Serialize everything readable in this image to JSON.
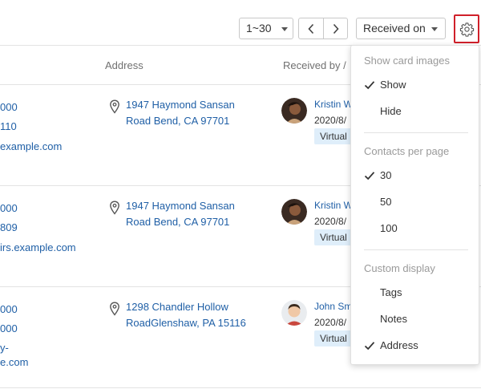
{
  "toolbar": {
    "pager_label": "1~30",
    "sort_label": "Received on"
  },
  "table": {
    "headers": {
      "address": "Address",
      "received_by": "Received by /"
    },
    "rows": [
      {
        "left_lines": [
          "000",
          "110",
          "example.com"
        ],
        "address_lines": [
          "1947 Haymond Sansan",
          "Road Bend, CA 97701"
        ],
        "received_name": "Kristin W",
        "received_date": "2020/8/",
        "tag": "Virtual"
      },
      {
        "left_lines": [
          "000",
          "809",
          "irs.example.com"
        ],
        "address_lines": [
          "1947 Haymond Sansan",
          "Road Bend, CA 97701"
        ],
        "received_name": "Kristin W",
        "received_date": "2020/8/",
        "tag": "Virtual"
      },
      {
        "left_lines": [
          "000",
          "000",
          "y-",
          "e.com"
        ],
        "address_lines": [
          "1298 Chandler Hollow",
          "RoadGlenshaw, PA 15116"
        ],
        "received_name": "John Sm",
        "received_date": "2020/8/",
        "tag": "Virtual"
      }
    ]
  },
  "menu": {
    "sections": [
      {
        "title": "Show card images",
        "items": [
          {
            "label": "Show",
            "checked": true
          },
          {
            "label": "Hide",
            "checked": false
          }
        ]
      },
      {
        "title": "Contacts per page",
        "items": [
          {
            "label": "30",
            "checked": true
          },
          {
            "label": "50",
            "checked": false
          },
          {
            "label": "100",
            "checked": false
          }
        ]
      },
      {
        "title": "Custom display",
        "items": [
          {
            "label": "Tags",
            "checked": false
          },
          {
            "label": "Notes",
            "checked": false
          },
          {
            "label": "Address",
            "checked": true
          }
        ]
      }
    ]
  },
  "colors": {
    "link": "#1f5fa6",
    "tag_bg": "#dfeefa",
    "highlight_border": "#d0202a",
    "muted": "#9a9a9a"
  }
}
